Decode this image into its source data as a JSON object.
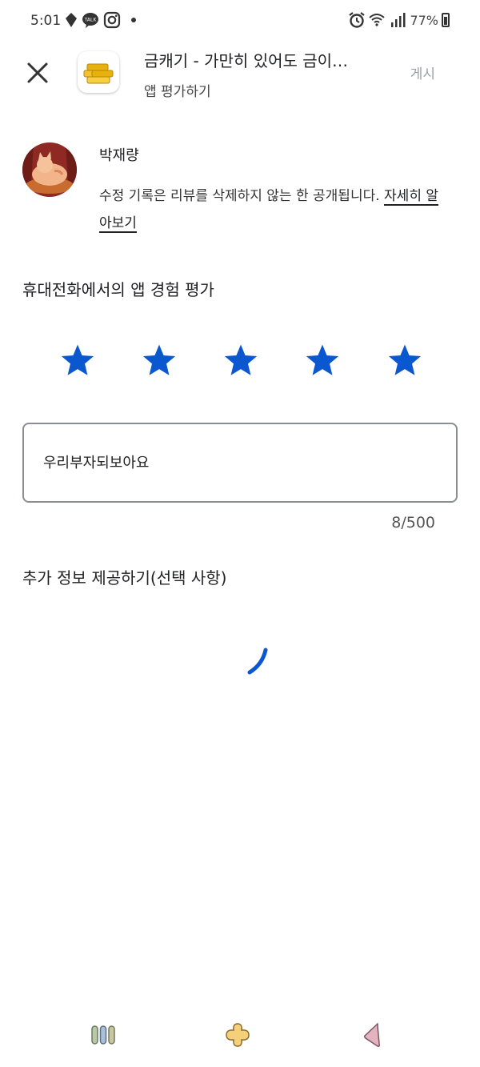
{
  "status_bar": {
    "time": "5:01",
    "icons": [
      "location-icon",
      "kakaotalk-icon",
      "instagram-icon",
      "dot-icon"
    ],
    "right_icons": [
      "alarm-icon",
      "wifi-icon",
      "signal-icon",
      "battery-icon"
    ],
    "battery_percent": "77%"
  },
  "header": {
    "close_icon": "close-icon",
    "app_icon": "gold-bars-icon",
    "app_title": "금캐기 - 가만히 있어도 금이…",
    "subtitle": "앱 평가하기",
    "post_label": "게시"
  },
  "user": {
    "avatar": "cat-avatar",
    "name": "박재량",
    "notice": "수정 기록은 리뷰를 삭제하지 않는 한 공개됩니다.",
    "learn_more": "자세히 알아보기"
  },
  "rating": {
    "title": "휴대전화에서의 앱 경험 평가",
    "value": 5,
    "max": 5,
    "star_color": "#0b57d0"
  },
  "review": {
    "text": "우리부자되보아요",
    "counter": "8/500"
  },
  "extra": {
    "title": "추가 정보 제공하기(선택 사항)"
  },
  "colors": {
    "accent": "#0b57d0",
    "post_disabled": "#9aa0a6"
  },
  "nav_bar": {
    "recent_icon": "recent-apps-icon",
    "home_icon": "home-icon",
    "back_icon": "back-icon"
  }
}
